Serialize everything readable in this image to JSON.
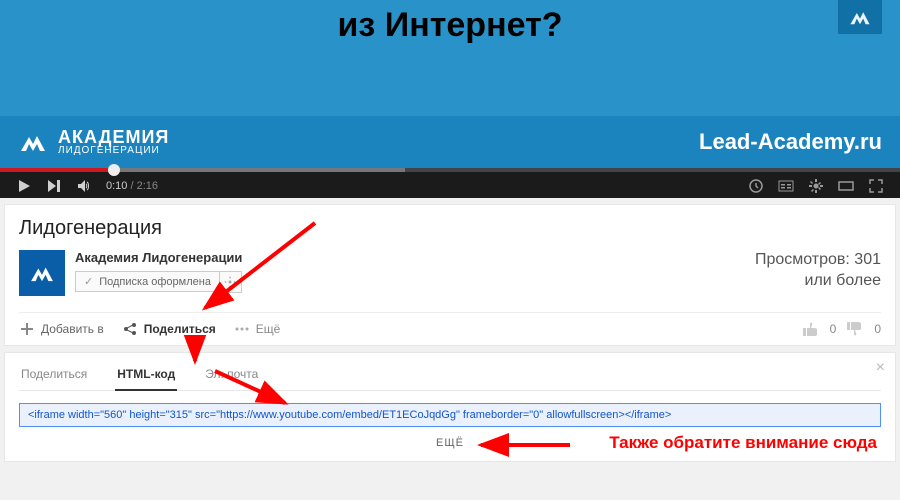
{
  "video": {
    "title_overlay": "из Интернет?",
    "academy_line1": "АКАДЕМИЯ",
    "academy_line2": "ЛИДОГЕНЕРАЦИИ",
    "lead_url": "Lead-Academy.ru"
  },
  "player": {
    "current_time": "0:10",
    "duration": "2:16"
  },
  "meta": {
    "title": "Лидогенерация",
    "channel": "Академия Лидогенерации",
    "subscribe_label": "Подписка оформлена",
    "views_line1": "Просмотров: 301",
    "views_line2": "или более",
    "add_to": "Добавить в",
    "share": "Поделиться",
    "more": "Ещё",
    "likes": "0",
    "dislikes": "0"
  },
  "share": {
    "tab_share": "Поделиться",
    "tab_embed": "HTML-код",
    "tab_email": "Эл. почта",
    "embed_code": "<iframe width=\"560\" height=\"315\" src=\"https://www.youtube.com/embed/ET1ECoJqdGg\" frameborder=\"0\" allowfullscreen></iframe>",
    "more_btn": "ЕЩЁ"
  },
  "callout": "Также обратите внимание сюда"
}
